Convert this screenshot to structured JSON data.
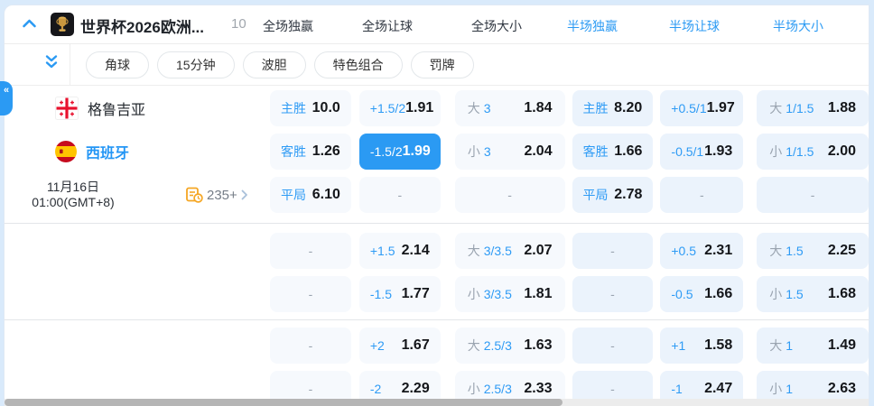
{
  "colors": {
    "accent": "#2b9af3",
    "selected_cell_bg": "#2b9af3",
    "cell_bg_full": "#f6f9fd",
    "cell_bg_half": "#ebf3fc"
  },
  "header": {
    "title": "世界杯2026欧洲...",
    "count": "10",
    "tabs": [
      {
        "label": "全场独赢",
        "highlight": false
      },
      {
        "label": "全场让球",
        "highlight": false
      },
      {
        "label": "全场大小",
        "highlight": false
      },
      {
        "label": "半场独赢",
        "highlight": true
      },
      {
        "label": "半场让球",
        "highlight": true
      },
      {
        "label": "半场大小",
        "highlight": true
      }
    ]
  },
  "toolbar": {
    "pills": [
      {
        "label": "角球"
      },
      {
        "label": "15分钟"
      },
      {
        "label": "波胆"
      },
      {
        "label": "特色组合"
      },
      {
        "label": "罚牌"
      }
    ]
  },
  "match": {
    "home_team": "格鲁吉亚",
    "away_team": "西班牙",
    "date": "11月16日",
    "time": "01:00(GMT+8)",
    "more_markets": "235+"
  },
  "odds": {
    "groups": [
      {
        "rows": [
          {
            "cells": [
              {
                "label": "主胜",
                "value": "10.0"
              },
              {
                "label": "+1.5/2",
                "value": "1.91"
              },
              {
                "prefix": "大",
                "label": "3",
                "value": "1.84"
              },
              {
                "label": "主胜",
                "value": "8.20"
              },
              {
                "label": "+0.5/1",
                "value": "1.97"
              },
              {
                "prefix": "大",
                "label": "1/1.5",
                "value": "1.88"
              }
            ]
          },
          {
            "cells": [
              {
                "label": "客胜",
                "value": "1.26"
              },
              {
                "label": "-1.5/2",
                "value": "1.99",
                "selected": true
              },
              {
                "prefix": "小",
                "label": "3",
                "value": "2.04"
              },
              {
                "label": "客胜",
                "value": "1.66"
              },
              {
                "label": "-0.5/1",
                "value": "1.93"
              },
              {
                "prefix": "小",
                "label": "1/1.5",
                "value": "2.00"
              }
            ]
          },
          {
            "cells": [
              {
                "label": "平局",
                "value": "6.10"
              },
              {
                "value": "-"
              },
              {
                "value": "-"
              },
              {
                "label": "平局",
                "value": "2.78"
              },
              {
                "value": "-"
              },
              {
                "value": "-"
              }
            ]
          }
        ]
      },
      {
        "rows": [
          {
            "cells": [
              {
                "value": "-"
              },
              {
                "label": "+1.5",
                "value": "2.14"
              },
              {
                "prefix": "大",
                "label": "3/3.5",
                "value": "2.07"
              },
              {
                "value": "-"
              },
              {
                "label": "+0.5",
                "value": "2.31"
              },
              {
                "prefix": "大",
                "label": "1.5",
                "value": "2.25"
              }
            ]
          },
          {
            "cells": [
              {
                "value": "-"
              },
              {
                "label": "-1.5",
                "value": "1.77"
              },
              {
                "prefix": "小",
                "label": "3/3.5",
                "value": "1.81"
              },
              {
                "value": "-"
              },
              {
                "label": "-0.5",
                "value": "1.66"
              },
              {
                "prefix": "小",
                "label": "1.5",
                "value": "1.68"
              }
            ]
          }
        ]
      },
      {
        "rows": [
          {
            "cells": [
              {
                "value": "-"
              },
              {
                "label": "+2",
                "value": "1.67"
              },
              {
                "prefix": "大",
                "label": "2.5/3",
                "value": "1.63"
              },
              {
                "value": "-"
              },
              {
                "label": "+1",
                "value": "1.58"
              },
              {
                "prefix": "大",
                "label": "1",
                "value": "1.49"
              }
            ]
          },
          {
            "cells": [
              {
                "value": "-"
              },
              {
                "label": "-2",
                "value": "2.29"
              },
              {
                "prefix": "小",
                "label": "2.5/3",
                "value": "2.33"
              },
              {
                "value": "-"
              },
              {
                "label": "-1",
                "value": "2.47"
              },
              {
                "prefix": "小",
                "label": "1",
                "value": "2.63"
              }
            ]
          }
        ]
      }
    ]
  }
}
